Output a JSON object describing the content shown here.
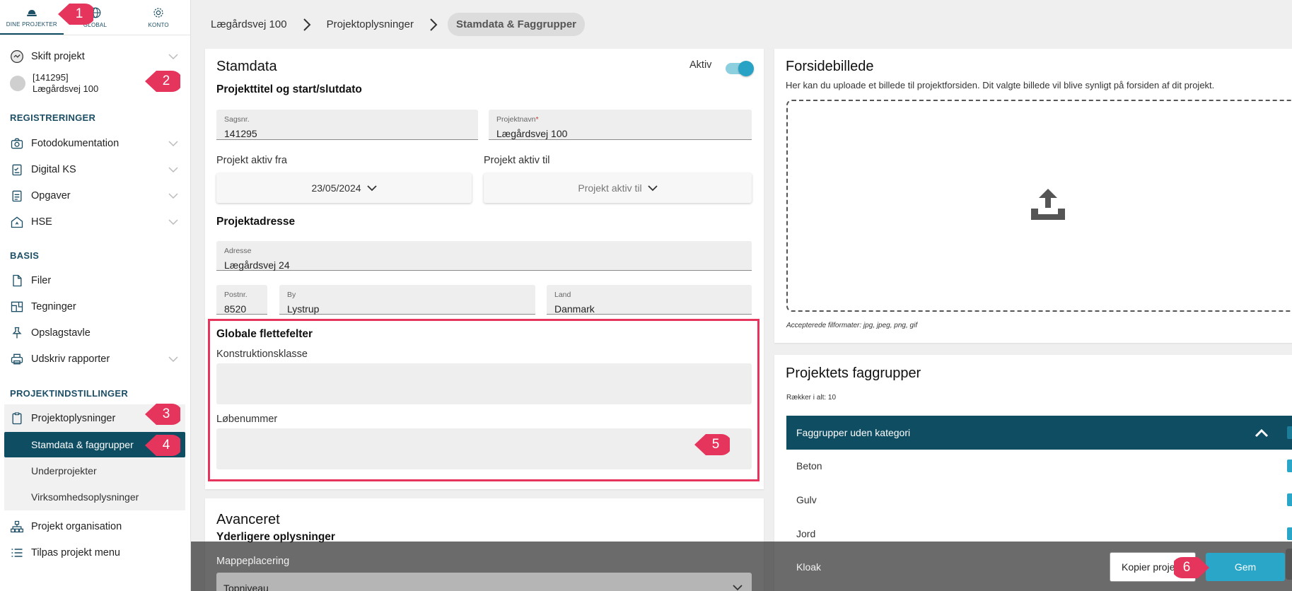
{
  "topnav": [
    {
      "label": "DINE PROJEKTER",
      "icon": "hard-hat-icon"
    },
    {
      "label": "GLOBAL",
      "icon": "globe-icon"
    },
    {
      "label": "KONTO",
      "icon": "gear-icon"
    }
  ],
  "sidebar": {
    "switch_project": "Skift projekt",
    "project_number": "[141295]",
    "project_name": "Lægårdsvej 100",
    "section_registreringer": "REGISTRERINGER",
    "registreringer": [
      "Fotodokumentation",
      "Digital KS",
      "Opgaver",
      "HSE"
    ],
    "section_basis": "BASIS",
    "basis": [
      "Filer",
      "Tegninger",
      "Opslagstavle",
      "Udskriv rapporter"
    ],
    "section_indstillinger": "PROJEKTINDSTILLINGER",
    "projektoplysninger": "Projektoplysninger",
    "subitems": [
      "Stamdata & faggrupper",
      "Underprojekter",
      "Virksomhedsoplysninger"
    ],
    "organisation": "Projekt organisation",
    "tilpas": "Tilpas projekt menu"
  },
  "breadcrumb": [
    "Lægårdsvej 100",
    "Projektoplysninger",
    "Stamdata & Faggrupper"
  ],
  "stamdata": {
    "title": "Stamdata",
    "active_label": "Aktiv",
    "subtitle": "Projekttitel og start/slutdato",
    "sagsnr_label": "Sagsnr.",
    "sagsnr_value": "141295",
    "projektnavn_label": "Projektnavn",
    "projektnavn_req": "*",
    "projektnavn_value": "Lægårdsvej 100",
    "aktiv_fra_label": "Projekt aktiv fra",
    "aktiv_fra_value": "23/05/2024",
    "aktiv_til_label": "Projekt aktiv til",
    "aktiv_til_value": "Projekt aktiv til",
    "adresse_title": "Projektadresse",
    "adresse_label": "Adresse",
    "adresse_value": "Lægårdsvej 24",
    "postnr_label": "Postnr.",
    "postnr_value": "8520",
    "by_label": "By",
    "by_value": "Lystrup",
    "land_label": "Land",
    "land_value": "Danmark",
    "globale_title": "Globale flettefelter",
    "konstruktion_label": "Konstruktionsklasse",
    "lobenummer_label": "Løbenummer"
  },
  "avanceret": {
    "title": "Avanceret",
    "subtitle": "Yderligere oplysninger",
    "mappe_label": "Mappeplacering",
    "mappe_value": "Topniveau"
  },
  "forside": {
    "title": "Forsidebillede",
    "desc": "Her kan du uploade et billede til projektforsiden. Dit valgte billede vil blive synligt på forsiden af dit projekt.",
    "formats": "Accepterede filformater: jpg, jpeg, png, gif"
  },
  "faggrupper": {
    "title": "Projektets faggrupper",
    "count": "Rækker i alt: 10",
    "group_header": "Faggrupper uden kategori",
    "rows": [
      "Beton",
      "Gulv",
      "Jord",
      "Kloak"
    ]
  },
  "buttons": {
    "kopier": "Kopier projekt",
    "gem": "Gem"
  },
  "badges": [
    "1",
    "2",
    "3",
    "4",
    "5",
    "6"
  ],
  "colors": {
    "primary": "#0f4d63",
    "accent": "#2aa6c8",
    "highlight": "#e5355c"
  }
}
